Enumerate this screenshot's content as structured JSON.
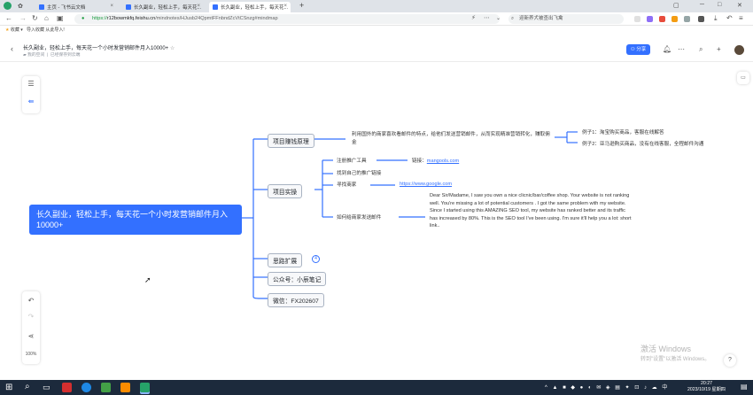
{
  "browser": {
    "tabs": [
      {
        "label": "主页 - 飞书云文档"
      },
      {
        "label": "长久副业，轻松上手，每天花..."
      },
      {
        "label": "长久副业，轻松上手，每天花..."
      }
    ],
    "new_tab": "+",
    "url_prefix": "https://",
    "url_host": "r12bowmkfq.feishu.cn",
    "url_path": "/mindnotes/HJusb24QpmtFFnbndZcVtCSnzg#mindmap",
    "search_placeholder": "迎新养犬被查出飞禽",
    "bookmarks": [
      "收藏",
      "导入收藏",
      "从此导入!"
    ]
  },
  "doc": {
    "title": "长久副业，轻松上手，每天花一个小时发营销邮件月入10000+",
    "breadcrumb_space": "我的空间",
    "save_status": "已经保存到云端",
    "share_label": "分享"
  },
  "mindmap": {
    "root": "长久副业，轻松上手，每天花一个小时发营销邮件月入10000+",
    "branches": [
      {
        "label": "项目赚钱原理"
      },
      {
        "label": "项目实操"
      },
      {
        "label": "思路扩展"
      },
      {
        "label": "公众号：小辰笔记"
      },
      {
        "label": "微信：FX202607"
      }
    ],
    "principle_text": "利用国外的商家喜欢看邮件的特点，给他们发送营销邮件，从而实现精准营销转化，赚取佣金",
    "examples": [
      "例子1：淘宝购买商品，客服在线解答",
      "例子2：亚马逊购买商品，没有在线客服，全程邮件沟通"
    ],
    "practice": [
      {
        "label": "注册推广工具"
      },
      {
        "label": "找到自己的推广链接"
      },
      {
        "label": "寻找商家"
      },
      {
        "label": "如何给商家发送邮件"
      }
    ],
    "tool_link_label": "链接：",
    "tool_link": "mangools.com",
    "merchant_link": "https://www.google.com",
    "email_text": "Dear Sir/Madame, I saw you own a nice clicnic/bar/coffee shop. Your website is not ranking well. You're missing a lot of potential customers . I got the same problem with my website. Since I started using this AMAZING SEO tool, my website has ranked better and its traffic has increased by 80%. This is the SEO tool I've been using. I'm sure it'll help you a lot: short link..",
    "expand_count": "4",
    "zoom": "100%"
  },
  "watermark": {
    "title": "激活 Windows",
    "subtitle": "转到\"设置\"以激活 Windows。"
  },
  "taskbar": {
    "time": "20:27",
    "date": "2023/10/19 星期四"
  },
  "colors": {
    "accent": "#3370ff",
    "taskbar": "#1c2a3c"
  }
}
